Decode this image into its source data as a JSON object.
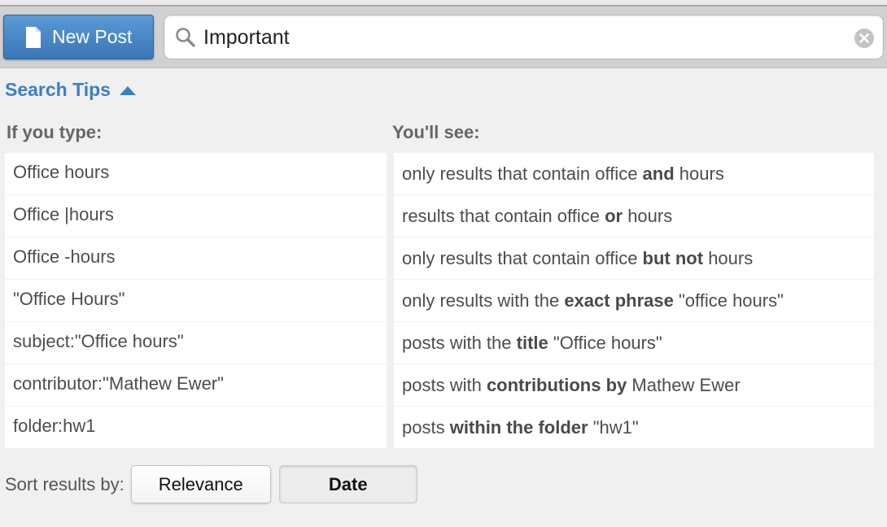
{
  "toolbar": {
    "new_post_label": "New Post",
    "new_post_icon": "document-icon",
    "search_icon": "search-icon",
    "clear_icon": "clear-icon"
  },
  "search": {
    "value": "Important"
  },
  "search_tips": {
    "toggle_label": "Search Tips",
    "toggle_icon": "triangle-up-icon",
    "col_input_header": "If you type:",
    "col_result_header": "You'll see:",
    "rows": [
      {
        "input": "Office hours",
        "result": [
          {
            "t": "only results that contain office "
          },
          {
            "t": "and",
            "b": true
          },
          {
            "t": " hours"
          }
        ]
      },
      {
        "input": "Office |hours",
        "result": [
          {
            "t": "results that contain office "
          },
          {
            "t": "or",
            "b": true
          },
          {
            "t": " hours"
          }
        ]
      },
      {
        "input": "Office -hours",
        "result": [
          {
            "t": "only results that contain office "
          },
          {
            "t": "but not",
            "b": true
          },
          {
            "t": " hours"
          }
        ]
      },
      {
        "input": "\"Office Hours\"",
        "result": [
          {
            "t": "only results with the "
          },
          {
            "t": "exact phrase",
            "b": true
          },
          {
            "t": " \"office hours\""
          }
        ]
      },
      {
        "input": "subject:\"Office hours\"",
        "result": [
          {
            "t": "posts with the "
          },
          {
            "t": "title",
            "b": true
          },
          {
            "t": " \"Office hours\""
          }
        ]
      },
      {
        "input": "contributor:\"Mathew Ewer\"",
        "result": [
          {
            "t": "posts with "
          },
          {
            "t": "contributions by",
            "b": true
          },
          {
            "t": " Mathew Ewer"
          }
        ]
      },
      {
        "input": "folder:hw1",
        "result": [
          {
            "t": "posts "
          },
          {
            "t": "within the folder",
            "b": true
          },
          {
            "t": " \"hw1\""
          }
        ]
      }
    ]
  },
  "sort": {
    "label": "Sort results by:",
    "options": [
      "Relevance",
      "Date"
    ],
    "selected": "Date"
  },
  "colors": {
    "accent": "#3d7fc3",
    "button_blue": "#4a88c9"
  }
}
